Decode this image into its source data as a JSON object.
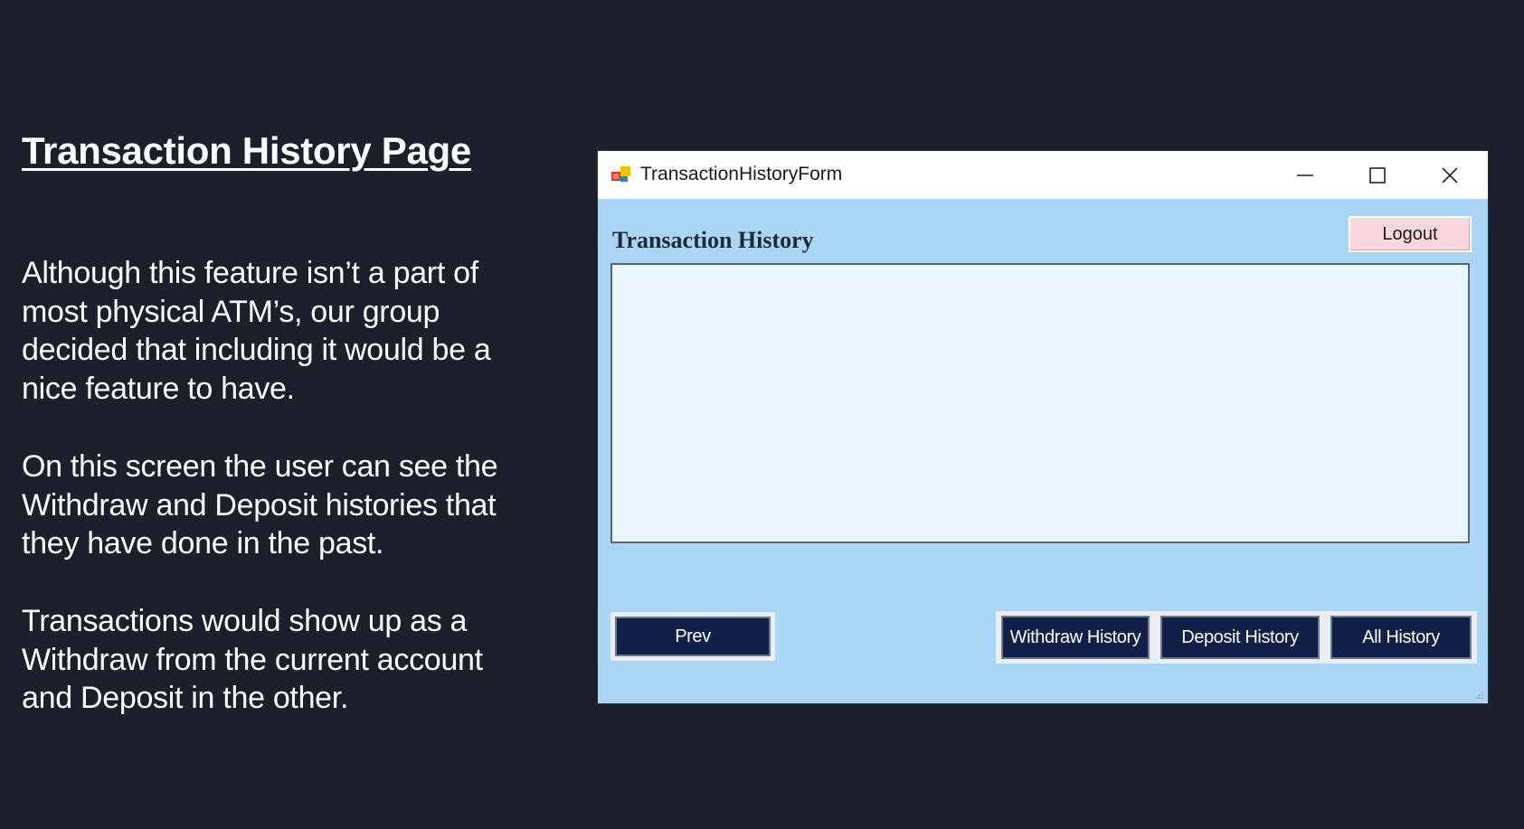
{
  "slide": {
    "title": "Transaction History Page",
    "paragraphs": [
      "Although this feature isn’t a part of\nmost physical ATM’s, our group\ndecided that including it would be a\nnice feature to have.",
      "On this screen the user can see the\nWithdraw and Deposit histories that\nthey have done in the past.",
      "Transactions would show up as a\nWithdraw from the current account\nand Deposit in the other."
    ]
  },
  "window": {
    "title": "TransactionHistoryForm",
    "controls": {
      "minimize": "minimize-icon",
      "maximize": "maximize-icon",
      "close": "close-icon"
    }
  },
  "form": {
    "heading": "Transaction History",
    "logout_label": "Logout",
    "history_items": [],
    "prev_label": "Prev",
    "withdraw_history_label": "Withdraw History",
    "deposit_history_label": "Deposit History",
    "all_history_label": "All History"
  },
  "colors": {
    "slide_background": "#1c202b",
    "form_background": "#aad5f4",
    "list_background": "#eaf6fd",
    "button_navy": "#102048",
    "logout_pink": "#f8d8dc"
  }
}
